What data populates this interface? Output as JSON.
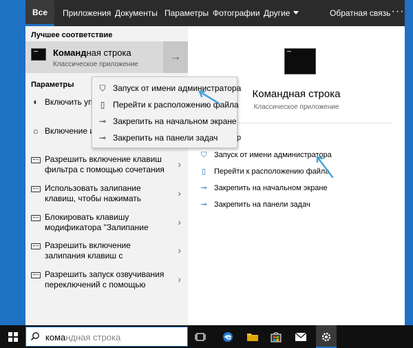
{
  "tabs": [
    {
      "label": "Все"
    },
    {
      "label": "Приложения"
    },
    {
      "label": "Документы"
    },
    {
      "label": "Параметры"
    },
    {
      "label": "Фотографии"
    },
    {
      "label": "Другие"
    }
  ],
  "feedback_label": "Обратная связь",
  "more_label": "···",
  "best_match": {
    "section_title": "Лучшее соответствие",
    "title_bold": "Команд",
    "title_rest": "ная строка",
    "subtitle": "Классическое приложение",
    "arrow": "→"
  },
  "settings": {
    "section_title": "Параметры",
    "items": [
      {
        "text": "Включить упр цветовыми ф",
        "icon": "brightness-icon"
      },
      {
        "text": "Включение и высокой конт",
        "icon": "sun-icon"
      },
      {
        "text": "Разрешить включение клавиш фильтра с помощью сочетания",
        "icon": "keyboard-icon"
      },
      {
        "text": "Использовать залипание клавиш, чтобы нажимать",
        "icon": "keyboard-icon"
      },
      {
        "text": "Блокировать клавишу модификатора \"Залипание",
        "icon": "keyboard-icon"
      },
      {
        "text": "Разрешить включение залипания клавиш с",
        "icon": "keyboard-icon"
      },
      {
        "text": "Разрешить запуск озвучивания переключений с помощью",
        "icon": "keyboard-icon"
      }
    ]
  },
  "context_menu": {
    "items": [
      {
        "label": "Запуск от имени администратора",
        "icon": "shield-icon"
      },
      {
        "label": "Перейти к расположению файла",
        "icon": "file-icon"
      },
      {
        "label": "Закрепить на начальном экране",
        "icon": "pin-icon"
      },
      {
        "label": "Закрепить на панели задач",
        "icon": "pin-icon"
      }
    ]
  },
  "details": {
    "title": "Командная строка",
    "subtitle": "Классическое приложение",
    "actions_header": "р",
    "actions": [
      {
        "label": "Запуск от имени администратора",
        "icon": "shield-icon"
      },
      {
        "label": "Перейти к расположению файла",
        "icon": "file-icon"
      },
      {
        "label": "Закрепить на начальном экране",
        "icon": "pin-icon"
      },
      {
        "label": "Закрепить на панели задач",
        "icon": "pin-icon"
      }
    ]
  },
  "search": {
    "typed": "кома",
    "rest": "ндная строка"
  },
  "colors": {
    "accent": "#1e72c4",
    "annotation_arrow": "#4aa3d8"
  }
}
